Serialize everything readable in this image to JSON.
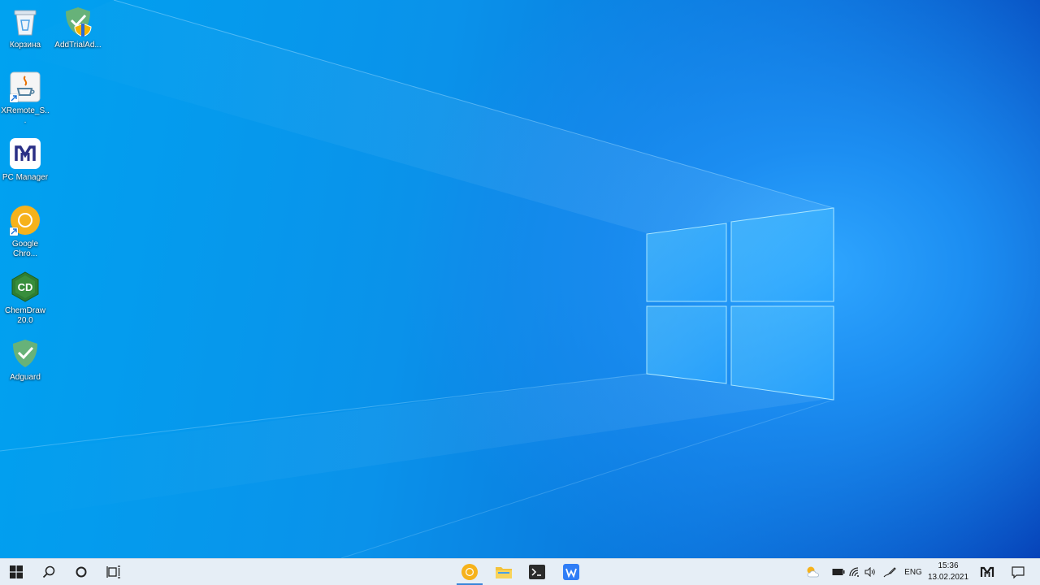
{
  "desktop": {
    "icons": [
      {
        "label": "Корзина",
        "icon": "recycle-bin-icon"
      },
      {
        "label": "AddTrialAd...",
        "icon": "adguard-shield-icon"
      },
      {
        "label": "XRemote_S...",
        "icon": "java-icon"
      },
      {
        "label": "PC Manager",
        "icon": "pc-manager-icon"
      },
      {
        "label": "Google Chro...",
        "icon": "chrome-icon"
      },
      {
        "label": "ChemDraw 20.0",
        "icon": "chemdraw-icon"
      },
      {
        "label": "Adguard",
        "icon": "adguard-icon"
      }
    ]
  },
  "taskbar": {
    "start": "windows-start-icon",
    "search": "search-icon",
    "cortana": "cortana-icon",
    "task_view": "task-view-icon",
    "pinned": [
      "chrome-icon",
      "file-explorer-icon",
      "terminal-icon",
      "wps-writer-icon"
    ],
    "tray": {
      "language": "ENG",
      "time": "15:36",
      "date": "13.02.2021"
    }
  },
  "colors": {
    "taskbar_bg": "#e6eef6",
    "active_indicator": "#3a86d8",
    "wallpaper_left": "#00a2f0",
    "wallpaper_right": "#0642b8"
  }
}
